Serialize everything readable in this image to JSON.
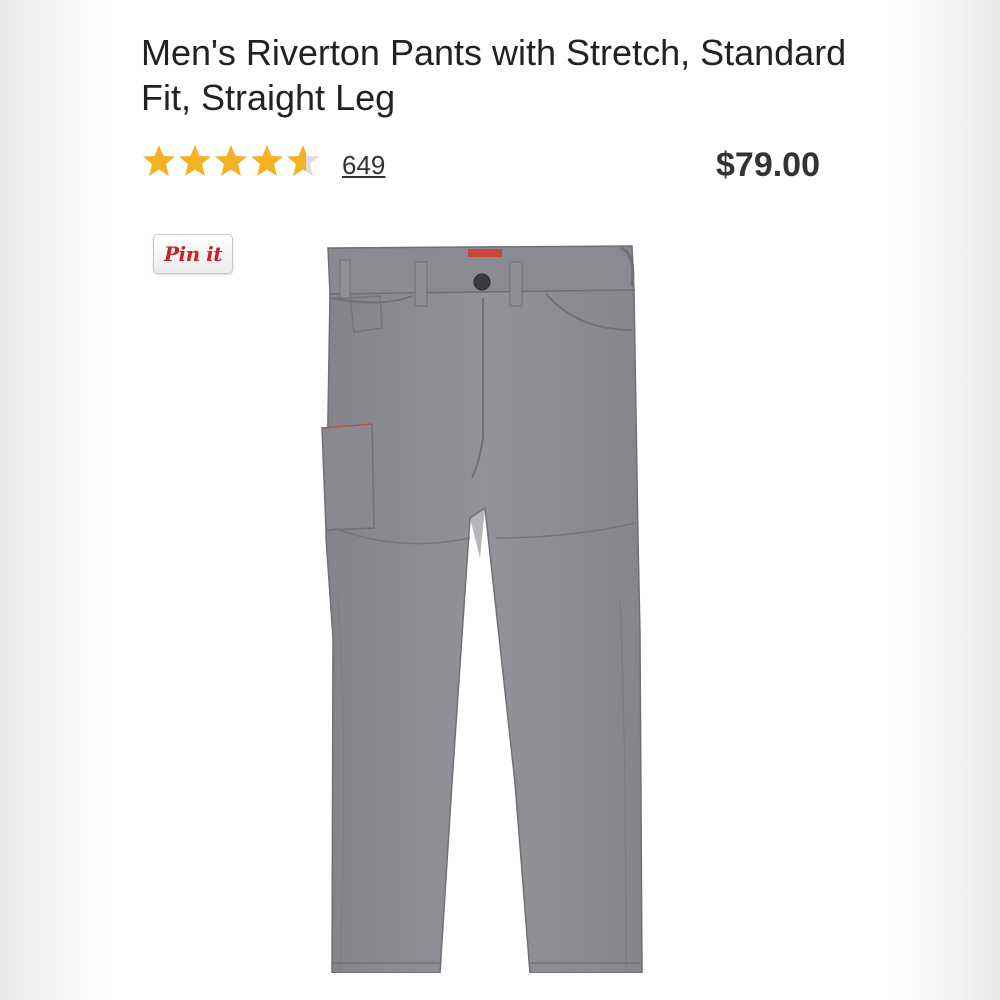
{
  "product": {
    "title": "Men's Riverton Pants with Stretch, Standard Fit, Straight Leg",
    "rating": 4.6,
    "rating_max": 5,
    "review_count": "649",
    "price": "$79.00",
    "image_alt": "gray-pants-photo"
  },
  "share": {
    "pin_label": "Pin it"
  },
  "colors": {
    "star": "#f4b121",
    "star_empty": "#dddddd",
    "pin_red": "#cb2027",
    "pants": "#8c8d92"
  }
}
